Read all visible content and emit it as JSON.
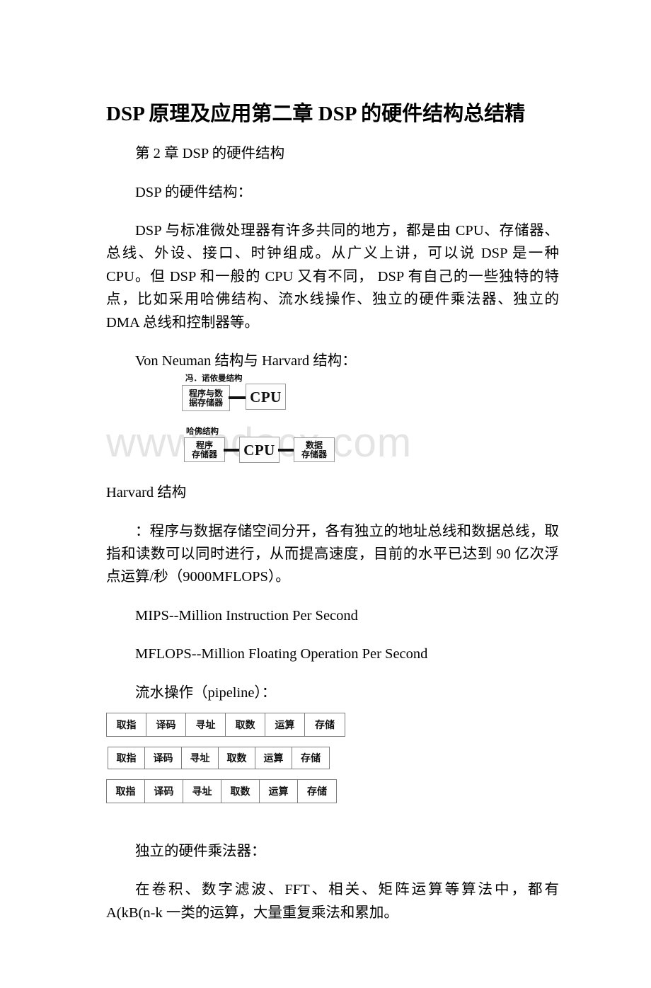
{
  "document": {
    "title": "DSP 原理及应用第二章 DSP 的硬件结构总结精",
    "watermark": "www.bdocx.com"
  },
  "body": {
    "chapter_heading": "第 2 章 DSP 的硬件结构",
    "section_1_heading": "DSP 的硬件结构：",
    "section_1_paragraph": "DSP 与标准微处理器有许多共同的地方，都是由 CPU、存储器、总线、外设、接口、时钟组成。从广义上讲，可以说 DSP 是一种 CPU。但 DSP 和一般的 CPU 又有不同， DSP 有自己的一些独特的特点，比如采用哈佛结构、流水线操作、独立的硬件乘法器、独立的 DMA 总线和控制器等。",
    "section_2_heading": "Von Neuman 结构与 Harvard 结构：",
    "harvard_label": "Harvard 结构",
    "harvard_paragraph": "：程序与数据存储空间分开，各有独立的地址总线和数据总线，取指和读数可以同时进行，从而提高速度，目前的水平已达到 90 亿次浮点运算/秒（9000MFLOPS）。",
    "mips_definition": "MIPS--Million Instruction Per Second",
    "mflops_definition": "MFLOPS--Million Floating Operation Per Second",
    "pipeline_heading": "流水操作（pipeline）：",
    "multiplier_heading": "独立的硬件乘法器：",
    "multiplier_paragraph": "在卷积、数字滤波、FFT、相关、矩阵运算等算法中，都有 A(kB(n-k 一类的运算，大量重复乘法和累加。"
  },
  "figure_architecture": {
    "von_neumann": {
      "caption": "冯．诺依曼结构",
      "memory_line_1": "程序与数",
      "memory_line_2": "据存储器",
      "cpu": "CPU"
    },
    "harvard": {
      "caption": "哈佛结构",
      "program_memory_line_1": "程序",
      "program_memory_line_2": "存储器",
      "cpu": "CPU",
      "data_memory_line_1": "数据",
      "data_memory_line_2": "存储器"
    }
  },
  "figure_pipeline": {
    "stages": [
      "取指",
      "译码",
      "寻址",
      "取数",
      "运算",
      "存储"
    ],
    "rows": [
      {
        "stages": [
          "取指",
          "译码",
          "寻址",
          "取数",
          "运算",
          "存储"
        ]
      },
      {
        "stages": [
          "取指",
          "译码",
          "寻址",
          "取数",
          "运算",
          "存储"
        ]
      },
      {
        "stages": [
          "取指",
          "译码",
          "寻址",
          "取数",
          "运算",
          "存储"
        ]
      }
    ]
  }
}
